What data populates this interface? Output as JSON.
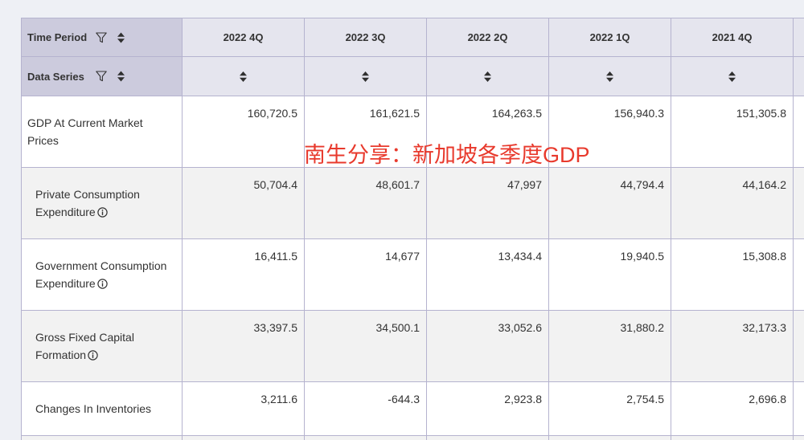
{
  "table": {
    "header": {
      "time_period_label": "Time Period",
      "data_series_label": "Data Series",
      "periods": [
        "2022 4Q",
        "2022 3Q",
        "2022 2Q",
        "2022 1Q",
        "2021 4Q"
      ]
    },
    "rows": [
      {
        "label": "GDP At Current Market Prices",
        "values": [
          "160,720.5",
          "161,621.5",
          "164,263.5",
          "156,940.3",
          "151,305.8"
        ]
      },
      {
        "label": "Private Consumption Expenditure",
        "info_icon": "info-icon",
        "values": [
          "50,704.4",
          "48,601.7",
          "47,997",
          "44,794.4",
          "44,164.2"
        ]
      },
      {
        "label": "Government Consumption Expenditure",
        "info_icon": "info-icon",
        "values": [
          "16,411.5",
          "14,677",
          "13,434.4",
          "19,940.5",
          "15,308.8"
        ]
      },
      {
        "label": "Gross Fixed Capital Formation",
        "info_icon": "info-icon",
        "values": [
          "33,397.5",
          "34,500.1",
          "33,052.6",
          "31,880.2",
          "32,173.3"
        ]
      },
      {
        "label": "Changes In Inventories",
        "values": [
          "3,211.6",
          "-644.3",
          "2,923.8",
          "2,754.5",
          "2,696.8"
        ]
      }
    ]
  },
  "watermark": {
    "text": "南生分享：新加坡各季度GDP"
  },
  "icons": {
    "filter": "filter-icon",
    "sort": "sort-icon",
    "info": "info-icon"
  },
  "colors": {
    "page_background": "#eef0f5",
    "header_label_background": "#cccbdd",
    "header_background": "#e5e5ee",
    "row_background": "#ffffff",
    "row_alt_background": "#f2f2f2",
    "border": "#b5b3cf",
    "text": "#333333",
    "watermark": "#e8392c"
  }
}
